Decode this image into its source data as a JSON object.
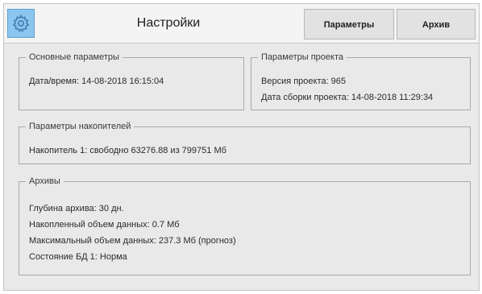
{
  "header": {
    "title": "Настройки",
    "tabs": [
      {
        "label": "Параметры"
      },
      {
        "label": "Архив"
      }
    ],
    "accent_color": "#8cc5ee"
  },
  "basic_params": {
    "legend": "Основные параметры",
    "datetime": "Дата/время: 14-08-2018 16:15:04"
  },
  "project_params": {
    "legend": "Параметры проекта",
    "version": "Версия проекта: 965",
    "build_date": "Дата сборки проекта: 14-08-2018 11:29:34"
  },
  "storage_params": {
    "legend": "Параметры накопителей",
    "drive1": "Накопитель 1: свободно 63276.88 из 799751 Мб"
  },
  "archives": {
    "legend": "Архивы",
    "depth": "Глубина архива: 30 дн.",
    "accumulated": "Накопленный объем данных: 0.7 Мб",
    "max": "Максимальный объем данных: 237.3 Мб (прогноз)",
    "db_state": "Состояние БД 1: Норма"
  },
  "icons": [
    "gear-icon"
  ]
}
